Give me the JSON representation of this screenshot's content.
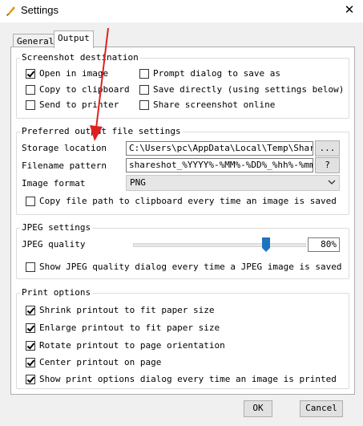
{
  "window": {
    "title": "Settings",
    "close_glyph": "✕",
    "app_icon": "brush-icon"
  },
  "tabs": [
    {
      "label": "General"
    },
    {
      "label": "Output",
      "selected": true
    }
  ],
  "screenshot_destination": {
    "title": "Screenshot destination",
    "options": [
      {
        "label": "Open in image",
        "checked": true
      },
      {
        "label": "Copy to clipboard",
        "checked": false
      },
      {
        "label": "Send to printer",
        "checked": false
      },
      {
        "label": "Prompt dialog to save as",
        "checked": false
      },
      {
        "label": "Save directly (using settings below)",
        "checked": false
      },
      {
        "label": "Share screenshot online",
        "checked": false
      }
    ]
  },
  "output_file": {
    "title": "Preferred output file settings",
    "storage_label": "Storage location",
    "storage_value": "C:\\Users\\pc\\AppData\\Local\\Temp\\ShareSh",
    "browse_label": "...",
    "pattern_label": "Filename pattern",
    "pattern_value": "shareshot_%YYYY%-%MM%-%DD%_%hh%-%mm%-%",
    "help_label": "?",
    "format_label": "Image format",
    "format_value": "PNG",
    "copy_path_label": "Copy file path to clipboard every time an image is saved",
    "copy_path_checked": false
  },
  "jpeg": {
    "title": "JPEG settings",
    "quality_label": "JPEG quality",
    "quality_percent": 80,
    "quality_text": "80%",
    "show_dialog_label": "Show JPEG quality dialog every time a JPEG image is saved",
    "show_dialog_checked": false
  },
  "print": {
    "title": "Print options",
    "options": [
      {
        "label": "Shrink printout to fit paper size",
        "checked": true
      },
      {
        "label": "Enlarge printout to fit paper size",
        "checked": true
      },
      {
        "label": "Rotate printout to page orientation",
        "checked": true
      },
      {
        "label": "Center printout on page",
        "checked": true
      },
      {
        "label": "Show print options dialog every time an image is printed",
        "checked": true
      }
    ]
  },
  "buttons": {
    "ok": "OK",
    "cancel": "Cancel"
  },
  "colors": {
    "accent_blue": "#1e73be",
    "annotation_red": "#e02020"
  }
}
